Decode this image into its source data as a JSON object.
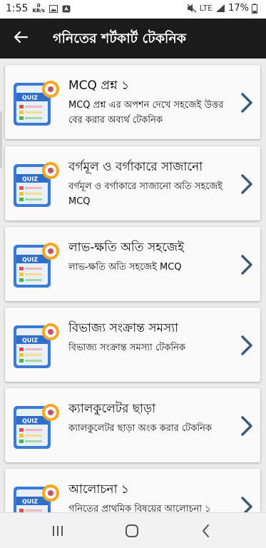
{
  "status": {
    "time": "1:55",
    "kb": "0\nKB/s",
    "network": "LTE",
    "battery": "17%"
  },
  "appbar": {
    "title": "গনিতের শর্টকার্ট টেকনিক"
  },
  "items": [
    {
      "title": "MCQ প্রশ্ন ১",
      "subtitle": "MCQ প্রশ্ন এর অপশন দেখে সহজেই উত্তর বের করার অব্যর্থ টেকনিক",
      "thumb_label": "QUIZ"
    },
    {
      "title": "বর্গমূল ও বর্গাকারে সাজানো",
      "subtitle": "বর্গমূল ও বর্গাকারে সাজানো অতি সহজেই MCQ",
      "thumb_label": "QUIZ"
    },
    {
      "title": "লাভ-ক্ষতি অতি সহজেই",
      "subtitle": "লাভ-ক্ষতি অতি সহজেই MCQ",
      "thumb_label": "QUIZ"
    },
    {
      "title": "বিভাজ্য সংক্রান্ত সমস্যা",
      "subtitle": "বিভাজ্য সংক্রান্ত সমস্যা টেকনিক",
      "thumb_label": "QUIZ"
    },
    {
      "title": "ক্যালকুলেটর ছাড়া",
      "subtitle": "ক্যালকুলেটর ছাড়া অংক করার  টেকনিক",
      "thumb_label": "QUIZ"
    },
    {
      "title": "আলোচনা ১",
      "subtitle": "গনিতের প্রাথমিক বিষয়ের আলোচনা ১",
      "thumb_label": "QUIZ"
    }
  ],
  "icons": {
    "back": "arrow-left-icon",
    "chevron": "chevron-right-icon",
    "nav_recent": "recent-apps-icon",
    "nav_home": "home-icon",
    "nav_back": "back-icon"
  },
  "colors": {
    "appbar": "#1b1b1b",
    "chevron": "#3d5a78",
    "card": "#fafafa",
    "background": "#ececec"
  }
}
